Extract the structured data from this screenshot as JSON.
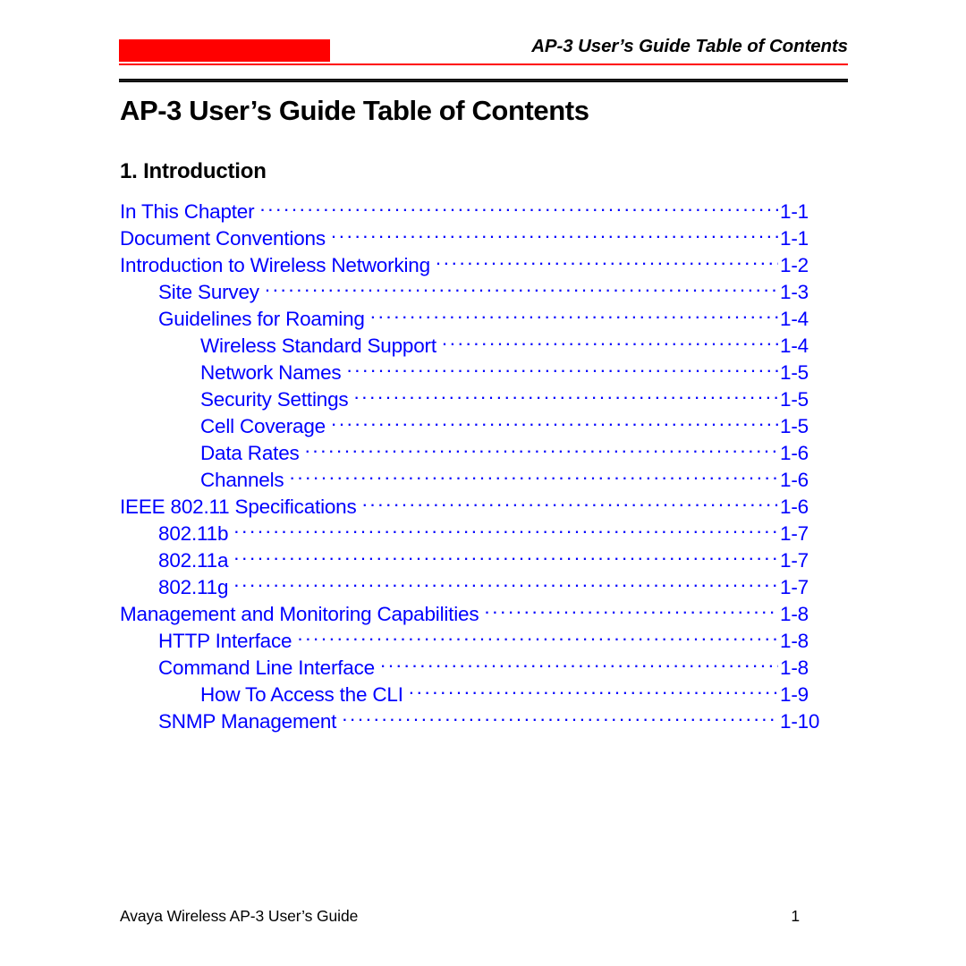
{
  "header": {
    "running_title": "AP-3 User’s Guide Table of Contents",
    "accent_color": "#ff0000",
    "rule_color": "#000000"
  },
  "document": {
    "title": "AP-3 User’s Guide Table of Contents",
    "link_color": "#0000ff"
  },
  "chapter": {
    "heading": "1. Introduction"
  },
  "toc": {
    "entries": [
      {
        "label": "In This Chapter",
        "page": "1-1",
        "level": 1
      },
      {
        "label": "Document Conventions",
        "page": "1-1",
        "level": 1
      },
      {
        "label": "Introduction to Wireless Networking",
        "page": "1-2",
        "level": 1
      },
      {
        "label": "Site Survey",
        "page": "1-3",
        "level": 2
      },
      {
        "label": "Guidelines for Roaming",
        "page": "1-4",
        "level": 2
      },
      {
        "label": "Wireless Standard Support",
        "page": "1-4",
        "level": 3
      },
      {
        "label": "Network Names",
        "page": "1-5",
        "level": 3
      },
      {
        "label": "Security Settings",
        "page": "1-5",
        "level": 3
      },
      {
        "label": "Cell Coverage",
        "page": "1-5",
        "level": 3
      },
      {
        "label": "Data Rates",
        "page": "1-6",
        "level": 3
      },
      {
        "label": "Channels",
        "page": "1-6",
        "level": 3
      },
      {
        "label": "IEEE 802.11 Specifications",
        "page": "1-6",
        "level": 1
      },
      {
        "label": "802.11b",
        "page": "1-7",
        "level": 2
      },
      {
        "label": "802.11a",
        "page": "1-7",
        "level": 2
      },
      {
        "label": "802.11g",
        "page": "1-7",
        "level": 2
      },
      {
        "label": "Management and Monitoring Capabilities",
        "page": "1-8",
        "level": 1
      },
      {
        "label": "HTTP Interface",
        "page": "1-8",
        "level": 2
      },
      {
        "label": "Command Line Interface",
        "page": "1-8",
        "level": 2
      },
      {
        "label": "How To Access the CLI",
        "page": "1-9",
        "level": 3
      },
      {
        "label": "SNMP Management",
        "page": "1-10",
        "level": 2
      }
    ]
  },
  "footer": {
    "left": "Avaya Wireless AP-3 User’s Guide",
    "page_number": "1"
  }
}
